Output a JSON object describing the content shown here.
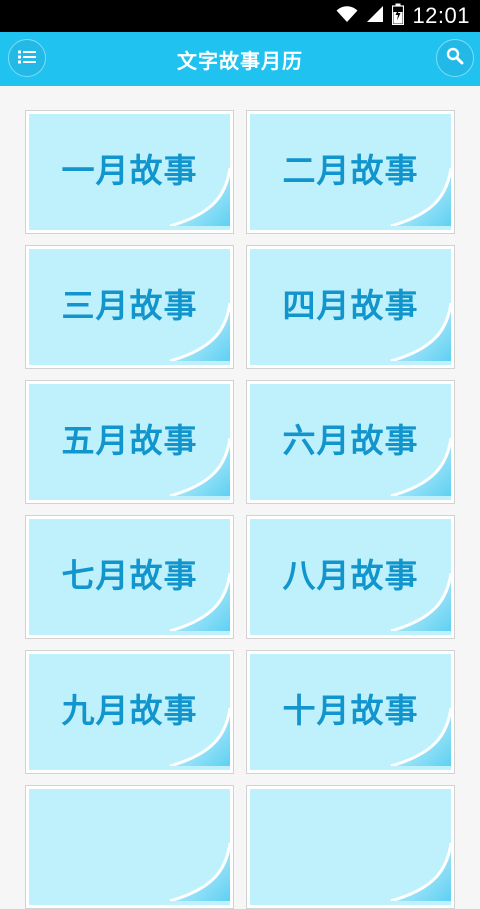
{
  "status_bar": {
    "time": "12:01",
    "icons": [
      "wifi-icon",
      "signal-icon",
      "battery-icon"
    ]
  },
  "header": {
    "title": "文字故事月历",
    "left_button_icon": "menu-list-icon",
    "right_button_icon": "search-icon"
  },
  "colors": {
    "header_bg": "#20c3ef",
    "card_paper": "#bff1fc",
    "card_text": "#1195cc",
    "page_bg": "#f6f6f6"
  },
  "months": [
    {
      "label": "一月故事"
    },
    {
      "label": "二月故事"
    },
    {
      "label": "三月故事"
    },
    {
      "label": "四月故事"
    },
    {
      "label": "五月故事"
    },
    {
      "label": "六月故事"
    },
    {
      "label": "七月故事"
    },
    {
      "label": "八月故事"
    },
    {
      "label": "九月故事"
    },
    {
      "label": "十月故事"
    },
    {
      "label": ""
    },
    {
      "label": ""
    }
  ]
}
